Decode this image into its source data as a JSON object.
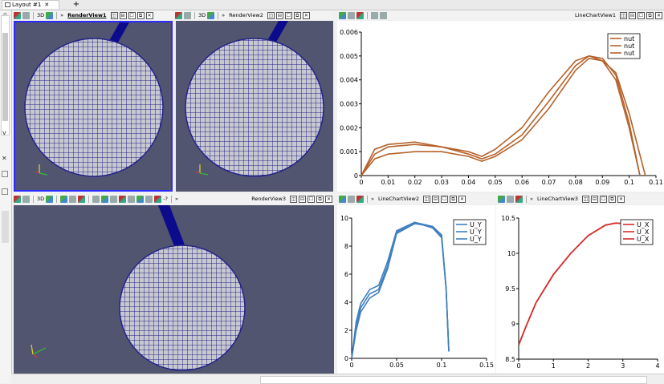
{
  "tabbar": {
    "tab_label": "Layout #1",
    "close_glyph": "✕",
    "new_tab_glyph": "+"
  },
  "leftpanel": {
    "up_arrow": "^",
    "down_arrow": "v",
    "close_glyph": "✕"
  },
  "views": {
    "renderview1": {
      "title": "RenderView1",
      "mode_3d": "3D"
    },
    "renderview2": {
      "title": "RenderView2",
      "mode_3d": "3D"
    },
    "renderview3": {
      "title": "RenderView3",
      "mode_3d": "3D",
      "extra": "-?"
    },
    "linechart1": {
      "title": "LineChartView1"
    },
    "linechart2": {
      "title": "LineChartView2"
    },
    "linechart3": {
      "title": "LineChartView3"
    }
  },
  "toolbar": {
    "more_glyph": "»",
    "split_h": "◫",
    "split_v": "⊟",
    "maximize": "☐",
    "pop_out": "⧉",
    "close": "✕"
  },
  "chart_data": [
    {
      "type": "line",
      "title": "",
      "xlim": [
        0,
        0.11
      ],
      "ylim": [
        0,
        0.006
      ],
      "x_ticks": [
        "0",
        "0.01",
        "0.02",
        "0.03",
        "0.04",
        "0.05",
        "0.06",
        "0.07",
        "0.08",
        "0.09",
        "0.1",
        "0.11"
      ],
      "y_ticks": [
        "0",
        "0.001",
        "0.002",
        "0.003",
        "0.004",
        "0.005",
        "0.006"
      ],
      "legend_position": "top-right",
      "color": "#b5622b",
      "series": [
        {
          "name": "nut",
          "x": [
            0,
            0.005,
            0.01,
            0.02,
            0.03,
            0.04,
            0.045,
            0.05,
            0.06,
            0.07,
            0.08,
            0.085,
            0.09,
            0.095,
            0.1,
            0.104
          ],
          "y": [
            0,
            0.0009,
            0.0012,
            0.0013,
            0.0012,
            0.0009,
            0.0007,
            0.0009,
            0.0017,
            0.0031,
            0.0046,
            0.005,
            0.0049,
            0.0042,
            0.0022,
            0
          ]
        },
        {
          "name": "nut",
          "x": [
            0,
            0.005,
            0.01,
            0.02,
            0.03,
            0.04,
            0.045,
            0.05,
            0.06,
            0.07,
            0.08,
            0.085,
            0.09,
            0.095,
            0.1,
            0.104
          ],
          "y": [
            0,
            0.0011,
            0.0013,
            0.0014,
            0.0012,
            0.001,
            0.0008,
            0.0011,
            0.002,
            0.0035,
            0.0048,
            0.005,
            0.0048,
            0.004,
            0.002,
            0
          ]
        },
        {
          "name": "nut",
          "x": [
            0,
            0.005,
            0.01,
            0.02,
            0.03,
            0.04,
            0.045,
            0.05,
            0.06,
            0.07,
            0.08,
            0.085,
            0.09,
            0.095,
            0.1,
            0.106
          ],
          "y": [
            0,
            0.0007,
            0.0009,
            0.001,
            0.001,
            0.0008,
            0.0006,
            0.0008,
            0.0015,
            0.0028,
            0.0044,
            0.0049,
            0.0048,
            0.0043,
            0.0026,
            0
          ]
        }
      ]
    },
    {
      "type": "line",
      "title": "",
      "xlim": [
        0,
        0.15
      ],
      "ylim": [
        0,
        10
      ],
      "x_ticks": [
        "0",
        "0.05",
        "0.1",
        "0.15"
      ],
      "y_ticks": [
        "0",
        "2",
        "4",
        "6",
        "8",
        "10"
      ],
      "legend_position": "top-right",
      "color": "#3f7fbf",
      "series": [
        {
          "name": "U_Y",
          "x": [
            0,
            0.005,
            0.01,
            0.02,
            0.03,
            0.04,
            0.05,
            0.07,
            0.09,
            0.1,
            0.105,
            0.108
          ],
          "y": [
            0,
            2.3,
            3.6,
            4.6,
            4.9,
            6.6,
            9.0,
            9.7,
            9.4,
            8.8,
            5.0,
            0.5
          ]
        },
        {
          "name": "U_Y",
          "x": [
            0,
            0.005,
            0.01,
            0.02,
            0.03,
            0.04,
            0.05,
            0.07,
            0.09,
            0.1,
            0.105,
            0.108
          ],
          "y": [
            0,
            2.6,
            3.9,
            4.9,
            5.2,
            6.9,
            9.1,
            9.7,
            9.3,
            8.6,
            5.0,
            0.5
          ]
        },
        {
          "name": "U_Y",
          "x": [
            0,
            0.005,
            0.01,
            0.02,
            0.03,
            0.04,
            0.05,
            0.07,
            0.09,
            0.1,
            0.105,
            0.108
          ],
          "y": [
            0,
            2.0,
            3.3,
            4.3,
            4.7,
            6.4,
            8.9,
            9.6,
            9.4,
            8.7,
            5.0,
            0.5
          ]
        }
      ]
    },
    {
      "type": "line",
      "title": "",
      "xlim": [
        0,
        4
      ],
      "ylim": [
        8.5,
        10.5
      ],
      "x_ticks": [
        "0",
        "1",
        "2",
        "3",
        "4"
      ],
      "y_ticks": [
        "8.5",
        "9",
        "9.5",
        "10",
        "10.5"
      ],
      "legend_position": "top-right",
      "color": "#d62b2b",
      "series": [
        {
          "name": "U_X",
          "x": [
            0,
            0.2,
            0.5,
            1,
            1.5,
            2,
            2.5,
            2.8,
            3.0,
            3.2
          ],
          "y": [
            8.7,
            8.95,
            9.3,
            9.7,
            10.0,
            10.25,
            10.4,
            10.43,
            10.42,
            10.38
          ]
        },
        {
          "name": "U_X",
          "x": [
            0,
            0.2,
            0.5,
            1,
            1.5,
            2,
            2.5,
            2.8,
            3.0,
            3.2
          ],
          "y": [
            8.7,
            8.95,
            9.3,
            9.7,
            10.0,
            10.25,
            10.4,
            10.43,
            10.42,
            10.38
          ]
        },
        {
          "name": "U_X",
          "x": [
            0,
            0.2,
            0.5,
            1,
            1.5,
            2,
            2.5,
            2.8,
            3.0,
            3.2
          ],
          "y": [
            8.7,
            8.95,
            9.3,
            9.7,
            10.0,
            10.25,
            10.4,
            10.43,
            10.42,
            10.38
          ]
        }
      ]
    }
  ]
}
